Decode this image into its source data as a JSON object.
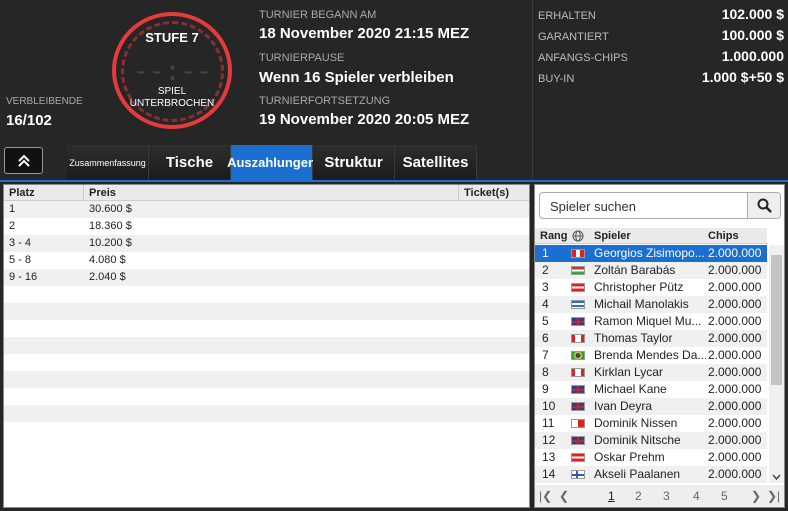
{
  "clock": {
    "level": "STUFE 7",
    "digits": "--:--",
    "status_line1": "SPIEL",
    "status_line2": "UNTERBROCHEN"
  },
  "remaining": {
    "label": "VERBLEIBENDE",
    "value": "16/102"
  },
  "tournament": {
    "start_label": "TURNIER BEGANN AM",
    "start_value": "18 November 2020  21:15 MEZ",
    "pause_label": "TURNIERPAUSE",
    "pause_value": "Wenn 16 Spieler verbleiben",
    "resume_label": "TURNIERFORTSETZUNG",
    "resume_value": "19 November 2020  20:05 MEZ"
  },
  "prize_info": [
    {
      "label": "ERHALTEN",
      "value": "102.000 $"
    },
    {
      "label": "GARANTIERT",
      "value": "100.000 $"
    },
    {
      "label": "ANFANGS-CHIPS",
      "value": "1.000.000"
    },
    {
      "label": "BUY-IN",
      "value": "1.000 $+50 $"
    }
  ],
  "tabs": [
    {
      "label": "Zusammenfassung",
      "active": false
    },
    {
      "label": "Tische",
      "active": false
    },
    {
      "label": "Auszahlungen",
      "active": true
    },
    {
      "label": "Struktur",
      "active": false
    },
    {
      "label": "Satellites",
      "active": false
    }
  ],
  "payouts": {
    "headers": [
      "Platz",
      "Preis",
      "Ticket(s)"
    ],
    "rows": [
      {
        "place": "1",
        "prize": "30.600 $"
      },
      {
        "place": "2",
        "prize": "18.360 $"
      },
      {
        "place": "3 - 4",
        "prize": "10.200 $"
      },
      {
        "place": "5 - 8",
        "prize": "4.080 $"
      },
      {
        "place": "9 - 16",
        "prize": "2.040 $"
      }
    ]
  },
  "players": {
    "search_placeholder": "Spieler suchen",
    "headers": {
      "rank": "Rang",
      "player": "Spieler",
      "chips": "Chips"
    },
    "rows": [
      {
        "rank": "1",
        "name": "Georgios Zisimopo...",
        "chips": "2.000.000",
        "flag": "peru"
      },
      {
        "rank": "2",
        "name": "Zoltán Barabás",
        "chips": "2.000.000",
        "flag": "hungary"
      },
      {
        "rank": "3",
        "name": "Christopher Pütz",
        "chips": "2.000.000",
        "flag": "austria"
      },
      {
        "rank": "4",
        "name": "Michail Manolakis",
        "chips": "2.000.000",
        "flag": "greece"
      },
      {
        "rank": "5",
        "name": "Ramon Miquel Mu...",
        "chips": "2.000.000",
        "flag": "uk"
      },
      {
        "rank": "6",
        "name": "Thomas Taylor",
        "chips": "2.000.000",
        "flag": "canada"
      },
      {
        "rank": "7",
        "name": "Brenda Mendes Da...",
        "chips": "2.000.000",
        "flag": "brazil"
      },
      {
        "rank": "8",
        "name": "Kirklan Lycar",
        "chips": "2.000.000",
        "flag": "canada"
      },
      {
        "rank": "9",
        "name": "Michael Kane",
        "chips": "2.000.000",
        "flag": "uk"
      },
      {
        "rank": "10",
        "name": "Ivan Deyra",
        "chips": "2.000.000",
        "flag": "uk"
      },
      {
        "rank": "11",
        "name": "Dominik Nissen",
        "chips": "2.000.000",
        "flag": "malta"
      },
      {
        "rank": "12",
        "name": "Dominik Nitsche",
        "chips": "2.000.000",
        "flag": "uk"
      },
      {
        "rank": "13",
        "name": "Oskar Prehm",
        "chips": "2.000.000",
        "flag": "austria"
      },
      {
        "rank": "14",
        "name": "Akseli Paalanen",
        "chips": "2.000.000",
        "flag": "finland"
      }
    ],
    "pages": [
      "1",
      "2",
      "3",
      "4",
      "5"
    ],
    "current_page": "1"
  },
  "colors": {
    "accent": "#1a6fd0",
    "clock_ring": "#e63b3b",
    "header_bg": "#262626"
  }
}
